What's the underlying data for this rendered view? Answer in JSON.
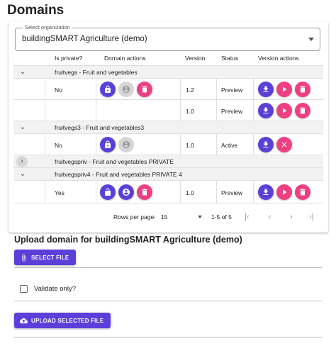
{
  "page": {
    "title": "Domains"
  },
  "organization": {
    "label": "Select organization",
    "value": "buildingSMART Agriculture (demo)"
  },
  "table": {
    "headers": {
      "private": "Is private?",
      "domain_actions": "Domain actions",
      "version": "Version",
      "status": "Status",
      "version_actions": "Version actions"
    },
    "groups": [
      {
        "label": "fruitvegs - Fruit and vegetables",
        "expanded": true,
        "rows": [
          {
            "private": "No",
            "version": "1.2",
            "status": "Preview",
            "lock": "locked",
            "person": "disabled",
            "domain_delete": true,
            "version_actions": [
              "download",
              "play",
              "delete"
            ]
          },
          {
            "private": "",
            "version": "1.0",
            "status": "Preview",
            "version_actions": [
              "download",
              "play",
              "delete"
            ]
          }
        ]
      },
      {
        "label": "fruitvegs3 - Fruit and vegetables3",
        "expanded": true,
        "rows": [
          {
            "private": "No",
            "version": "1.0",
            "status": "Active",
            "lock": "locked",
            "person": "disabled",
            "domain_delete": false,
            "version_actions": [
              "download",
              "close"
            ]
          }
        ]
      },
      {
        "label": "fruitvegspriv - Fruit and vegetables PRIVATE",
        "expanded": false,
        "rows": []
      },
      {
        "label": "fruitvegspriv4 - Fruit and vegetables PRIVATE 4",
        "expanded": true,
        "rows": [
          {
            "private": "Yes",
            "version": "1.0",
            "status": "Preview",
            "lock": "unlocked",
            "person": "enabled",
            "domain_delete": true,
            "version_actions": [
              "download",
              "play",
              "delete"
            ]
          }
        ]
      }
    ],
    "pagination": {
      "rows_per_page_label": "Rows per page:",
      "rows_per_page": "15",
      "range": "1-5 of 5"
    }
  },
  "upload": {
    "title": "Upload domain for buildingSMART Agriculture (demo)",
    "select_file_label": "SELECT FILE",
    "validate_label": "Validate only?",
    "validate_checked": false,
    "upload_label": "UPLOAD SELECTED FILE"
  },
  "colors": {
    "primary": "#5b3fd9",
    "danger": "#ee3f82",
    "disabled": "#d6d6d6",
    "group_bg": "#f2f2f2"
  }
}
